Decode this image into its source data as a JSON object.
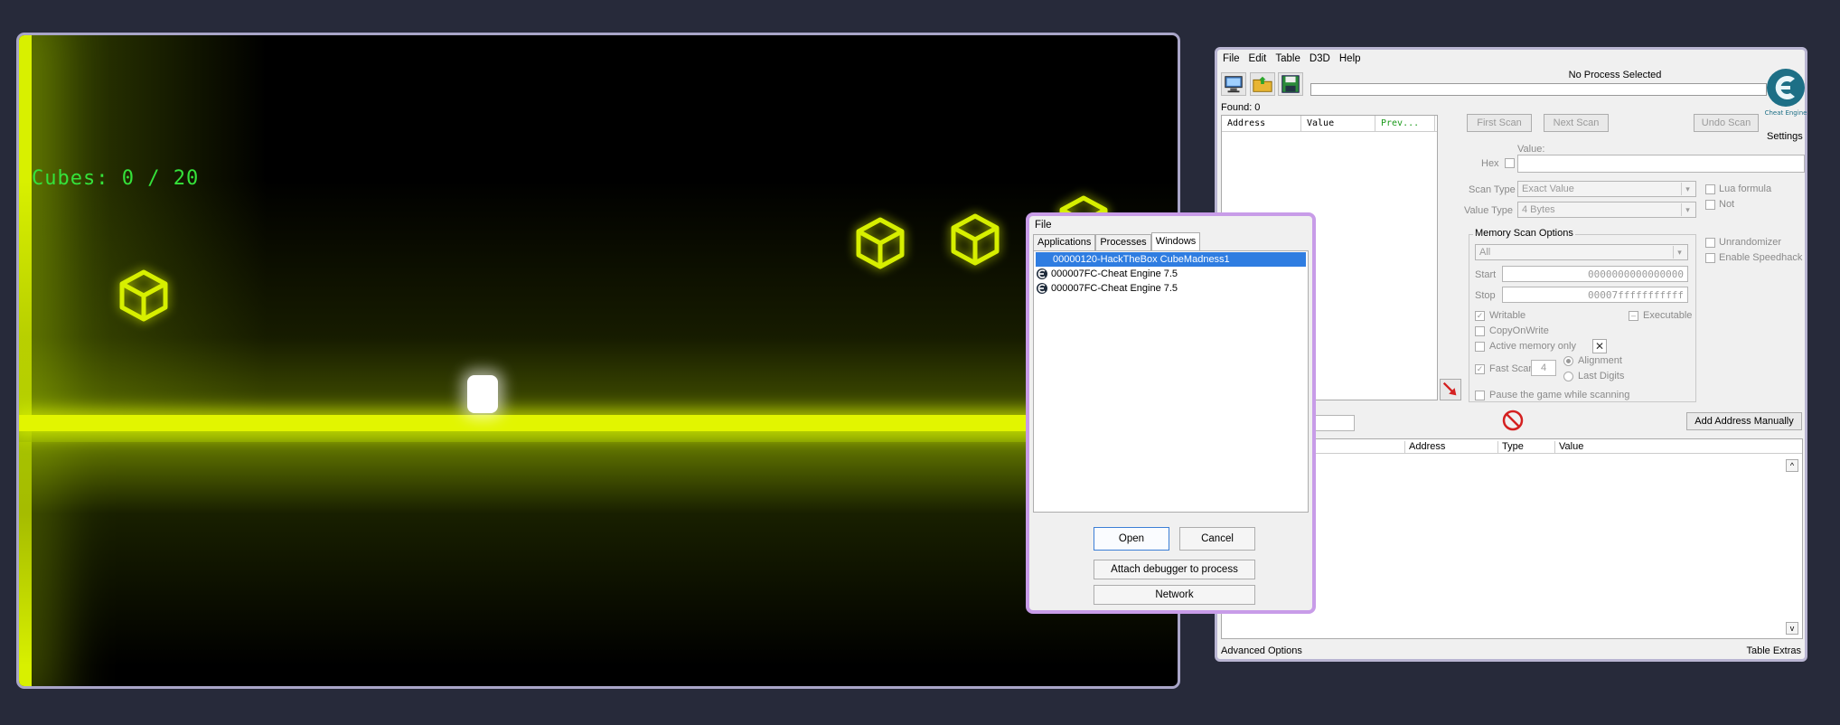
{
  "game": {
    "hud_text": "Cubes: 0 / 20",
    "accent_color": "#e2f500",
    "hud_color": "#35e23a",
    "cube_icon": "wireframe-cube-icon"
  },
  "cheat_engine": {
    "menu": [
      "File",
      "Edit",
      "Table",
      "D3D",
      "Help"
    ],
    "process_title": "No Process Selected",
    "found_label": "Found: 0",
    "settings_label": "Settings",
    "columns_top": [
      "Address",
      "Value",
      "Prev..."
    ],
    "buttons": {
      "first_scan": "First Scan",
      "next_scan": "Next Scan",
      "undo_scan": "Undo Scan",
      "add_address": "Add Address Manually"
    },
    "value_label": "Value:",
    "hex_label": "Hex",
    "scan_type_label": "Scan Type",
    "scan_type_value": "Exact Value",
    "value_type_label": "Value Type",
    "value_type_value": "4 Bytes",
    "lua_formula": "Lua formula",
    "not_label": "Not",
    "memory_scan_options": "Memory Scan Options",
    "region_value": "All",
    "start_label": "Start",
    "start_value": "0000000000000000",
    "stop_label": "Stop",
    "stop_value": "00007fffffffffff",
    "writable": "Writable",
    "executable": "Executable",
    "copyonwrite": "CopyOnWrite",
    "active_memory_only": "Active memory only",
    "fast_scan": "Fast Scan",
    "fast_scan_value": "4",
    "alignment": "Alignment",
    "last_digits": "Last Digits",
    "pause_game": "Pause the game while scanning",
    "unrandomizer": "Unrandomizer",
    "enable_speedhack": "Enable Speedhack",
    "columns_bottom": [
      "Address",
      "Type",
      "Value"
    ],
    "advanced_options": "Advanced Options",
    "table_extras": "Table Extras"
  },
  "dialog": {
    "title": "File",
    "tabs": [
      "Applications",
      "Processes",
      "Windows"
    ],
    "processes": [
      "00000120-HackTheBox CubeMadness1",
      "000007FC-Cheat Engine 7.5",
      "000007FC-Cheat Engine 7.5"
    ],
    "open": "Open",
    "cancel": "Cancel",
    "attach": "Attach debugger to process",
    "network": "Network"
  }
}
